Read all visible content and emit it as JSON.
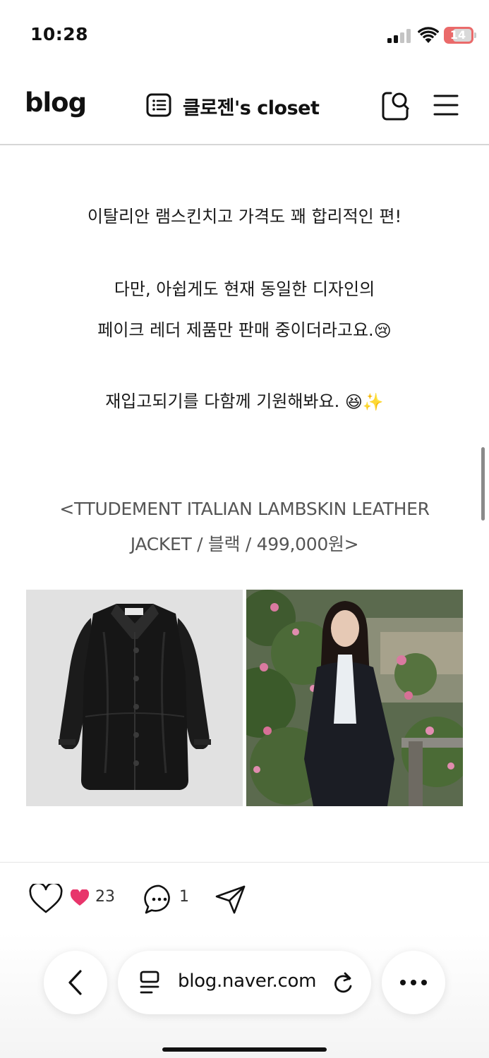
{
  "status_bar": {
    "time": "10:28",
    "battery": "14",
    "battery_color": "#ea6a6a"
  },
  "header": {
    "logo": "blog",
    "blog_title": "클로젠's closet",
    "icons": [
      "list-icon",
      "search-icon",
      "menu-icon"
    ]
  },
  "post": {
    "paragraphs": [
      {
        "lines": [
          {
            "text": "이탈리안 램스킨치고 가격도 꽤 합리적인 편!"
          }
        ]
      },
      {
        "lines": [
          {
            "text": "다만, 아쉽게도 현재 동일한 디자인의"
          },
          {
            "text": "페이크 레더 제품만 판매 중이더라고요.",
            "emoji": "😢"
          }
        ]
      },
      {
        "lines": [
          {
            "text": "재입고되기를 다함께 기원해봐요.",
            "emoji": "😆✨"
          }
        ]
      }
    ],
    "caption_lines": [
      "<TTUDEMENT ITALIAN LAMBSKIN LEATHER",
      "JACKET / 블랙 / 499,000원>"
    ],
    "images": [
      {
        "name": "product-image-jacket",
        "subject": "black leather jacket"
      },
      {
        "name": "product-image-model",
        "subject": "woman wearing leather jacket by water"
      }
    ]
  },
  "reactions": {
    "like_count": "23",
    "comment_count": "1",
    "heart_color": "#e8356b"
  },
  "browser": {
    "url": "blog.naver.com"
  }
}
